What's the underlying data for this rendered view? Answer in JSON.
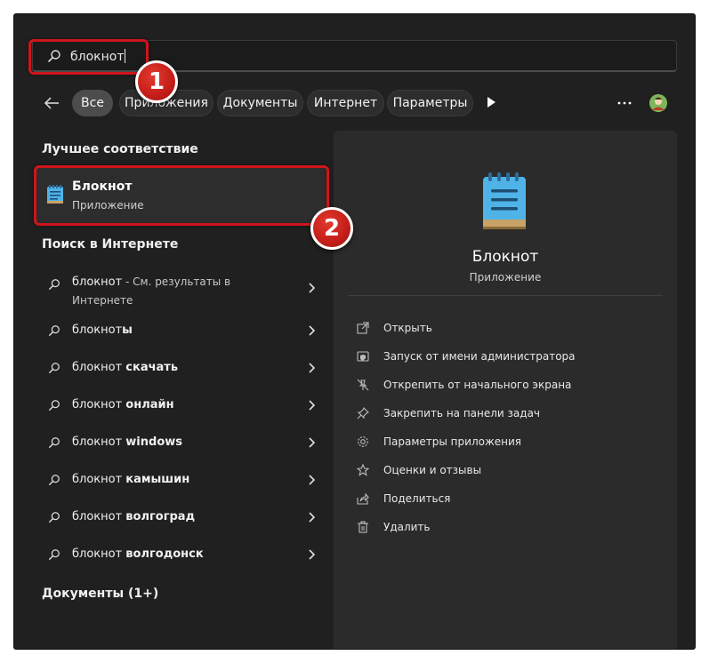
{
  "search": {
    "query": "блокнот"
  },
  "filters": {
    "items": [
      {
        "label": "Все",
        "active": true
      },
      {
        "label": "Приложения",
        "active": false
      },
      {
        "label": "Документы",
        "active": false
      },
      {
        "label": "Интернет",
        "active": false
      },
      {
        "label": "Параметры",
        "active": false
      }
    ]
  },
  "markers": {
    "first": "1",
    "second": "2"
  },
  "left": {
    "best_match_title": "Лучшее соответствие",
    "best_match": {
      "name": "Блокнот",
      "kind": "Приложение"
    },
    "web_title": "Поиск в Интернете",
    "web_items": [
      {
        "prefix": "блокнот",
        "bold": "",
        "suffix": " - См. результаты в",
        "sub": "Интернете"
      },
      {
        "prefix": "блокнот",
        "bold": "ы",
        "suffix": "",
        "sub": ""
      },
      {
        "prefix": "блокнот ",
        "bold": "скачать",
        "suffix": "",
        "sub": ""
      },
      {
        "prefix": "блокнот ",
        "bold": "онлайн",
        "suffix": "",
        "sub": ""
      },
      {
        "prefix": "блокнот ",
        "bold": "windows",
        "suffix": "",
        "sub": ""
      },
      {
        "prefix": "блокнот ",
        "bold": "камышин",
        "suffix": "",
        "sub": ""
      },
      {
        "prefix": "блокнот ",
        "bold": "волгоград",
        "suffix": "",
        "sub": ""
      },
      {
        "prefix": "блокнот ",
        "bold": "волгодонск",
        "suffix": "",
        "sub": ""
      }
    ],
    "docs_title": "Документы (1+)"
  },
  "right": {
    "title": "Блокнот",
    "kind": "Приложение",
    "actions": [
      {
        "label": "Открыть",
        "icon": "open-icon"
      },
      {
        "label": "Запуск от имени администратора",
        "icon": "admin-shield-icon"
      },
      {
        "label": "Открепить от начального экрана",
        "icon": "unpin-icon"
      },
      {
        "label": "Закрепить на панели задач",
        "icon": "pin-icon"
      },
      {
        "label": "Параметры приложения",
        "icon": "gear-icon"
      },
      {
        "label": "Оценки и отзывы",
        "icon": "star-icon"
      },
      {
        "label": "Поделиться",
        "icon": "share-icon"
      },
      {
        "label": "Удалить",
        "icon": "trash-icon"
      }
    ]
  },
  "colors": {
    "panel_bg": "#202020",
    "highlight": "#d0141b",
    "accent_notepad": "#4fb3e8"
  }
}
